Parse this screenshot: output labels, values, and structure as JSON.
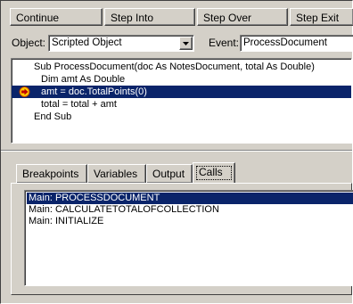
{
  "toolbar": {
    "continue_label": "Continue",
    "step_into_label": "Step Into",
    "step_over_label": "Step Over",
    "step_exit_label": "Step Exit"
  },
  "object_selector": {
    "label": "Object:",
    "value": "Scripted Object"
  },
  "event_selector": {
    "label": "Event:",
    "value": "ProcessDocument"
  },
  "code": {
    "lines": [
      "Sub ProcessDocument(doc As NotesDocument, total As Double)",
      "Dim amt As Double",
      "amt = doc.TotalPoints(0)",
      "total = total + amt",
      "End Sub"
    ],
    "current_line": 3
  },
  "tabs": [
    {
      "label": "Breakpoints"
    },
    {
      "label": "Variables"
    },
    {
      "label": "Output"
    },
    {
      "label": "Calls"
    }
  ],
  "active_tab": "Calls",
  "calls": {
    "items": [
      "Main: PROCESSDOCUMENT",
      "Main: CALCULATETOTALOFCOLLECTION",
      "Main: INITIALIZE"
    ],
    "selected_index": 0
  },
  "colors": {
    "face": "#d4d0c8",
    "selection": "#0a246a",
    "arrow_marker": "#ffcc00"
  }
}
